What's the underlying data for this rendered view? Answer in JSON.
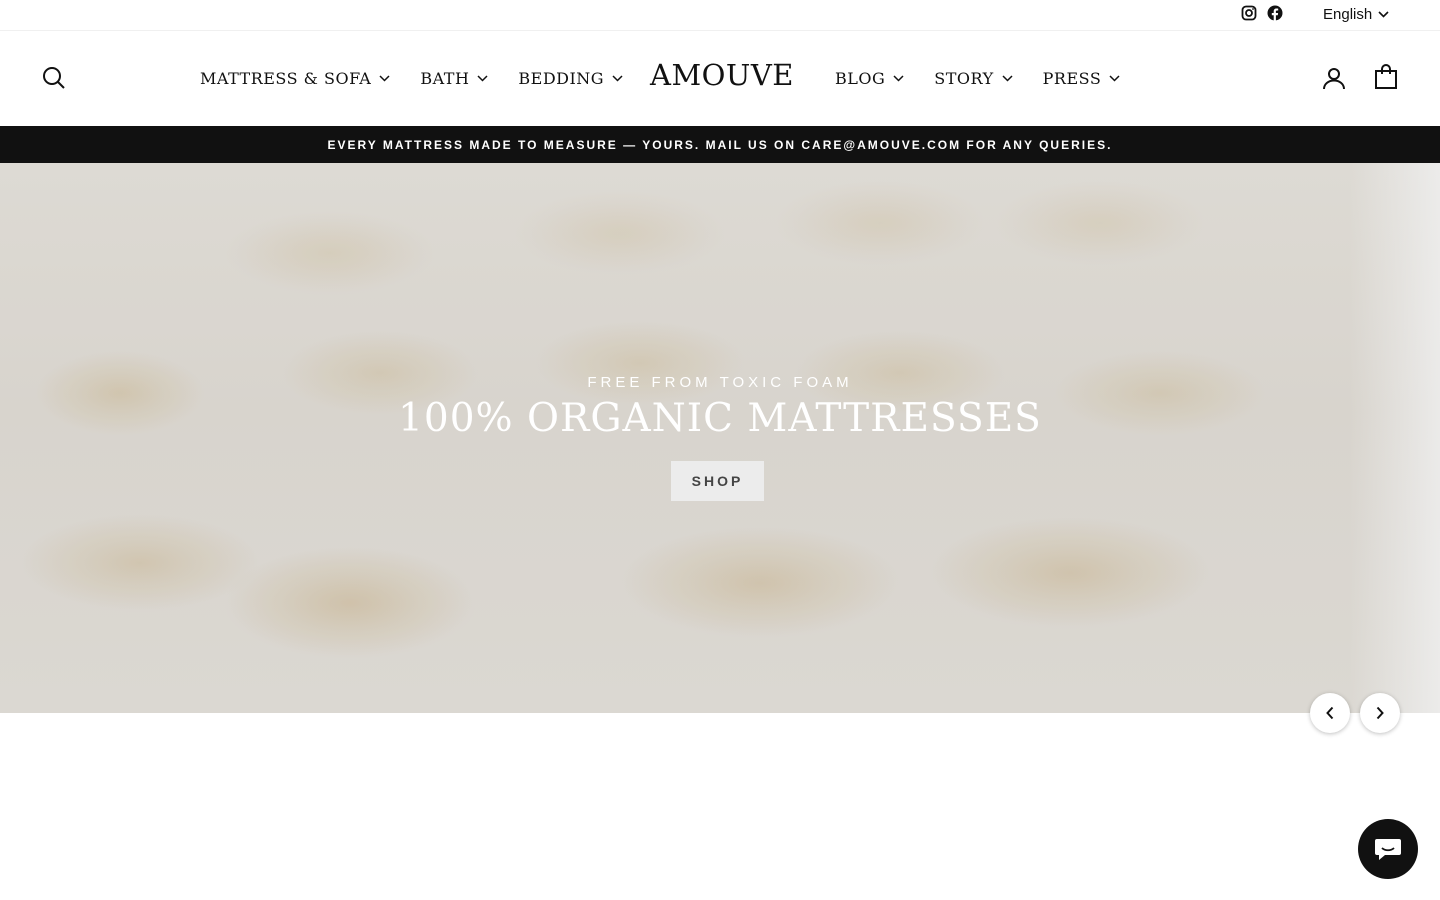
{
  "utility_bar": {
    "social_icons": [
      "instagram-icon",
      "facebook-icon"
    ],
    "language_label": "English"
  },
  "header": {
    "logo": "AMOUVE",
    "nav_left": [
      {
        "label": "MATTRESS & SOFA",
        "icon": "chevron-down-icon"
      },
      {
        "label": "BATH",
        "icon": "chevron-down-icon"
      },
      {
        "label": "BEDDING",
        "icon": "chevron-down-icon"
      }
    ],
    "nav_right": [
      {
        "label": "BLOG",
        "icon": "chevron-down-icon"
      },
      {
        "label": "STORY",
        "icon": "chevron-down-icon"
      },
      {
        "label": "PRESS",
        "icon": "chevron-down-icon"
      }
    ],
    "icons": [
      "search-icon",
      "account-icon",
      "cart-icon"
    ]
  },
  "announcement": {
    "text": "EVERY MATTRESS MADE TO MEASURE — YOURS. MAIL US ON CARE@AMOUVE.COM FOR ANY QUERIES."
  },
  "hero": {
    "subtitle": "FREE FROM TOXIC FOAM",
    "title": "100% ORGANIC MATTRESSES",
    "button_label": "SHOP",
    "carousel_icons": [
      "chevron-left-icon",
      "chevron-right-icon"
    ]
  },
  "colors": {
    "announcement_bg": "#111111",
    "chat_bg": "#111111",
    "text": "#111111"
  },
  "chat": {
    "icon": "chat-icon"
  }
}
